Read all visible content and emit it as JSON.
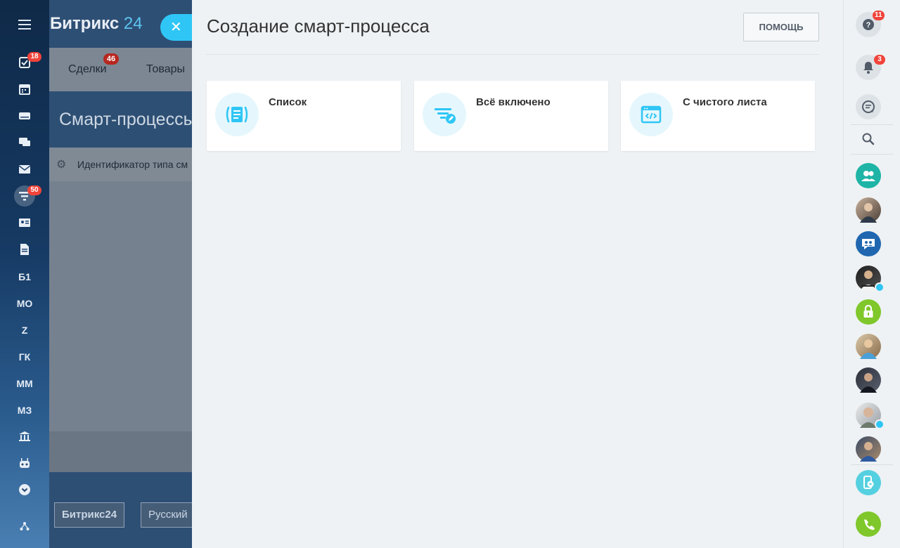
{
  "app": {
    "logo_text": "Битрикс",
    "logo_num": "24"
  },
  "left_nav": {
    "badges": {
      "tasks": "18",
      "funnel": "50"
    },
    "text_items": [
      "Б1",
      "МО",
      "Z",
      "ГК",
      "ММ",
      "МЗ"
    ]
  },
  "background": {
    "tabs": [
      {
        "label": "Сделки",
        "badge": "46"
      },
      {
        "label": "Товары"
      }
    ],
    "page_title": "Смарт-процессы",
    "grid_header": "Идентификатор типа см",
    "footer": {
      "brand": "Битрикс24",
      "language": "Русский"
    }
  },
  "slider": {
    "title": "Создание смарт-процесса",
    "help_label": "ПОМОЩЬ",
    "cards": [
      {
        "label": "Список",
        "icon": "list-icon"
      },
      {
        "label": "Всё включено",
        "icon": "filter-edit-icon"
      },
      {
        "label": "С чистого листа",
        "icon": "code-window-icon"
      }
    ]
  },
  "right_rail": {
    "help_badge": "11",
    "notifications_badge": "3"
  },
  "colors": {
    "accent": "#2fc6f6",
    "badge": "#f0443a",
    "panel_bg": "#eef2f4",
    "icon_circle": "#e5f7fd"
  }
}
